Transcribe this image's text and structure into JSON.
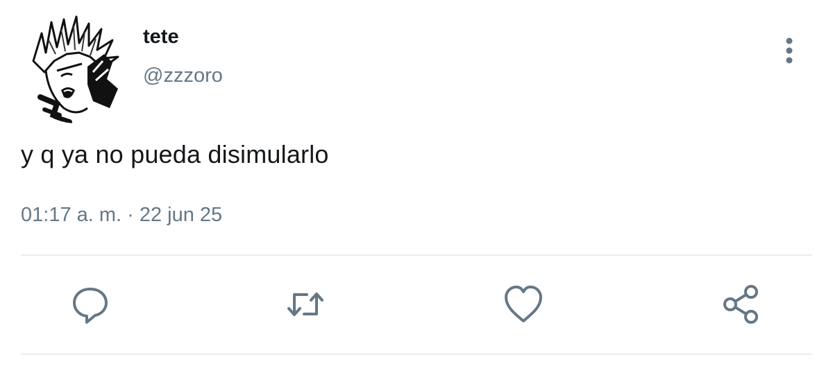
{
  "tweet": {
    "display_name": "tete",
    "handle": "@zzzoro",
    "text": "y q ya no pueda disimularlo",
    "timestamp": "01:17 a. m. · 22 jun 25"
  },
  "icons": {
    "more": "more-vertical-icon",
    "reply": "reply-icon",
    "retweet": "retweet-icon",
    "like": "heart-icon",
    "share": "share-icon"
  },
  "colors": {
    "text": "#14171a",
    "secondary": "#657786",
    "divider": "#e6ecf0"
  }
}
